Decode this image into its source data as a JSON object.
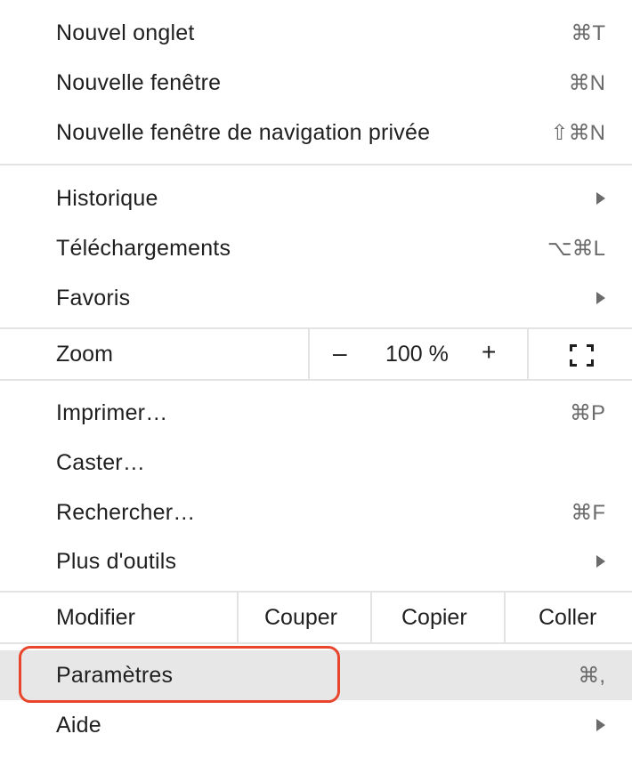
{
  "menu": {
    "new_tab": {
      "label": "Nouvel onglet",
      "shortcut": "⌘T"
    },
    "new_window": {
      "label": "Nouvelle fenêtre",
      "shortcut": "⌘N"
    },
    "new_incognito": {
      "label": "Nouvelle fenêtre de navigation privée",
      "shortcut": "⇧⌘N"
    },
    "history": {
      "label": "Historique"
    },
    "downloads": {
      "label": "Téléchargements",
      "shortcut": "⌥⌘L"
    },
    "bookmarks": {
      "label": "Favoris"
    },
    "zoom": {
      "label": "Zoom",
      "minus": "–",
      "value": "100 %",
      "plus": "+"
    },
    "print": {
      "label": "Imprimer…",
      "shortcut": "⌘P"
    },
    "cast": {
      "label": "Caster…"
    },
    "find": {
      "label": "Rechercher…",
      "shortcut": "⌘F"
    },
    "more_tools": {
      "label": "Plus d'outils"
    },
    "edit": {
      "label": "Modifier",
      "cut": "Couper",
      "copy": "Copier",
      "paste": "Coller"
    },
    "settings": {
      "label": "Paramètres",
      "shortcut": "⌘,"
    },
    "help": {
      "label": "Aide"
    }
  },
  "colors": {
    "highlight": "#e7e7e7",
    "focus_ring": "#e8452c"
  }
}
